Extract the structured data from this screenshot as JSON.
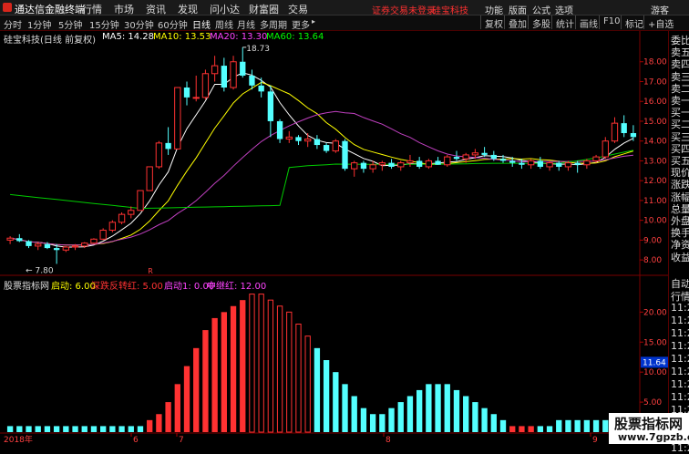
{
  "menubar": {
    "app_title": "通达信金融终端",
    "items": [
      "行情",
      "市场",
      "资讯",
      "发现",
      "问小达",
      "财富圈",
      "交易"
    ],
    "notice": "证券交易未登录",
    "stock": "硅宝科技",
    "right_items": [
      "功能",
      "版面",
      "公式",
      "选项"
    ],
    "guest": "游客"
  },
  "toolbar": {
    "periods": [
      "分时",
      "1分钟",
      "5分钟",
      "15分钟",
      "30分钟",
      "60分钟",
      "日线",
      "周线",
      "月线",
      "多周期",
      "更多"
    ],
    "active_period": "日线",
    "right_buttons": [
      "复权",
      "叠加",
      "多股",
      "统计",
      "画线",
      "F10",
      "标记",
      "+自选"
    ]
  },
  "main_chart": {
    "title": "硅宝科技(日线 前复权)",
    "ma_labels": [
      {
        "text": "MA5: 14.28",
        "color": "#ffffff"
      },
      {
        "text": "MA10: 13.53",
        "color": "#ffff00"
      },
      {
        "text": "MA20: 13.30",
        "color": "#ff44ff"
      },
      {
        "text": "MA60: 13.64",
        "color": "#00ff00"
      }
    ],
    "high_label": "18.73",
    "low_label": "7.80",
    "price_ticks": [
      "18.00",
      "17.00",
      "16.00",
      "15.00",
      "14.00",
      "13.00",
      "12.00",
      "11.00",
      "10.00",
      "9.00",
      "8.00"
    ],
    "marker_r": "R"
  },
  "sub_chart": {
    "title": "股票指标网",
    "legend": [
      {
        "text": "启动: 6.00",
        "color": "#ffff00"
      },
      {
        "text": "深跌反转红: 5.00",
        "color": "#ff3333"
      },
      {
        "text": "启动1: 0.00",
        "color": "#ff44ff"
      },
      {
        "text": "中继红: 12.00",
        "color": "#ff44ff"
      }
    ],
    "ticks": [
      "20.00",
      "15.00",
      "10.00",
      "5.00"
    ],
    "current_value": "11.64"
  },
  "xaxis": {
    "labels": [
      "2018年",
      "6",
      "7",
      "8",
      "9"
    ]
  },
  "right_panel": {
    "items": [
      "委比",
      "卖五",
      "卖四",
      "卖三",
      "卖二",
      "卖一",
      "买一",
      "买二",
      "买三",
      "买四",
      "买五",
      "现价",
      "涨跌",
      "涨幅",
      "总量",
      "外盘",
      "换手",
      "净资",
      "收益"
    ],
    "lower": [
      "自动",
      "行情",
      "11:2",
      "11:2",
      "11:2",
      "11:2",
      "11:2",
      "11:2",
      "11:2",
      "11:2",
      "11:2",
      "11:2",
      "11:2",
      "11:2"
    ]
  },
  "watermark": {
    "line1": "股票指标网",
    "line2": "www.7gpzb.com"
  },
  "colors": {
    "up": "#ff3232",
    "down": "#54ffff",
    "ma5": "#ffffff",
    "ma10": "#ffff00",
    "ma20": "#c040c0",
    "ma60": "#00cc00"
  },
  "chart_data": {
    "type": "candlestick",
    "candles": [
      [
        9.0,
        9.2,
        8.8,
        9.1
      ],
      [
        9.1,
        9.3,
        8.9,
        8.95
      ],
      [
        8.95,
        9.0,
        8.6,
        8.7
      ],
      [
        8.7,
        8.9,
        8.5,
        8.8
      ],
      [
        8.8,
        8.9,
        8.55,
        8.6
      ],
      [
        8.6,
        8.8,
        7.8,
        8.5
      ],
      [
        8.5,
        8.7,
        8.4,
        8.65
      ],
      [
        8.65,
        8.8,
        8.5,
        8.7
      ],
      [
        8.7,
        8.9,
        8.6,
        8.85
      ],
      [
        8.85,
        9.1,
        8.8,
        9.05
      ],
      [
        9.05,
        9.6,
        9.0,
        9.5
      ],
      [
        9.5,
        10.0,
        9.4,
        9.9
      ],
      [
        9.9,
        10.4,
        9.8,
        10.3
      ],
      [
        10.3,
        10.7,
        10.1,
        10.5
      ],
      [
        10.5,
        11.5,
        10.5,
        11.5
      ],
      [
        11.5,
        12.7,
        11.5,
        12.7
      ],
      [
        12.7,
        14.0,
        12.6,
        13.9
      ],
      [
        13.9,
        14.7,
        13.3,
        13.6
      ],
      [
        13.6,
        16.7,
        13.6,
        16.7
      ],
      [
        16.7,
        17.0,
        15.8,
        16.2
      ],
      [
        16.2,
        17.3,
        16.0,
        16.2
      ],
      [
        16.2,
        17.6,
        16.1,
        17.4
      ],
      [
        17.4,
        18.3,
        17.0,
        17.8
      ],
      [
        17.8,
        18.2,
        16.5,
        16.7
      ],
      [
        16.7,
        18.3,
        16.6,
        18.0
      ],
      [
        18.0,
        18.73,
        17.2,
        17.3
      ],
      [
        17.3,
        17.6,
        16.6,
        16.8
      ],
      [
        16.8,
        17.2,
        16.2,
        16.5
      ],
      [
        16.5,
        16.8,
        14.2,
        15.0
      ],
      [
        15.0,
        15.1,
        13.9,
        14.1
      ],
      [
        14.1,
        14.5,
        13.9,
        14.2
      ],
      [
        14.2,
        14.3,
        13.8,
        14.0
      ],
      [
        14.0,
        14.4,
        13.7,
        14.1
      ],
      [
        14.1,
        14.3,
        13.6,
        13.8
      ],
      [
        13.8,
        13.9,
        13.4,
        13.5
      ],
      [
        13.5,
        14.1,
        13.4,
        14.0
      ],
      [
        14.0,
        14.1,
        12.5,
        12.6
      ],
      [
        12.6,
        13.0,
        12.2,
        12.9
      ],
      [
        12.9,
        13.0,
        12.4,
        12.6
      ],
      [
        12.6,
        13.0,
        12.4,
        12.8
      ],
      [
        12.8,
        13.0,
        12.5,
        12.9
      ],
      [
        12.9,
        13.1,
        12.6,
        12.7
      ],
      [
        12.7,
        13.0,
        12.5,
        12.9
      ],
      [
        12.9,
        13.3,
        12.7,
        13.0
      ],
      [
        13.0,
        13.2,
        12.6,
        12.7
      ],
      [
        12.7,
        13.1,
        12.6,
        13.0
      ],
      [
        13.0,
        13.2,
        12.8,
        12.8
      ],
      [
        12.8,
        13.3,
        12.7,
        13.2
      ],
      [
        13.2,
        13.5,
        13.0,
        13.1
      ],
      [
        13.1,
        13.4,
        12.9,
        13.3
      ],
      [
        13.3,
        13.6,
        13.1,
        13.4
      ],
      [
        13.4,
        13.7,
        13.2,
        13.3
      ],
      [
        13.3,
        13.5,
        13.0,
        13.1
      ],
      [
        13.1,
        13.3,
        12.9,
        13.0
      ],
      [
        13.0,
        13.2,
        12.7,
        12.9
      ],
      [
        12.9,
        13.1,
        12.6,
        12.8
      ],
      [
        12.8,
        13.1,
        12.6,
        13.0
      ],
      [
        13.0,
        13.2,
        12.6,
        12.7
      ],
      [
        12.7,
        13.0,
        12.5,
        12.9
      ],
      [
        12.9,
        13.0,
        12.5,
        12.7
      ],
      [
        12.7,
        13.0,
        12.5,
        12.9
      ],
      [
        12.9,
        13.0,
        12.4,
        12.8
      ],
      [
        12.8,
        13.1,
        12.6,
        13.0
      ],
      [
        13.0,
        13.3,
        12.9,
        13.2
      ],
      [
        13.2,
        14.2,
        13.1,
        14.0
      ],
      [
        14.0,
        15.2,
        13.9,
        14.9
      ],
      [
        14.9,
        15.3,
        14.2,
        14.4
      ],
      [
        14.4,
        14.8,
        14.0,
        14.2
      ]
    ],
    "indicator": {
      "bars": [
        1,
        1,
        1,
        1,
        1,
        1,
        1,
        1,
        1,
        1,
        1,
        1,
        1,
        1,
        1,
        2,
        3,
        5,
        8,
        11,
        14,
        17,
        19,
        20,
        21,
        22,
        23,
        23,
        22,
        21,
        20,
        18,
        16,
        14,
        12,
        10,
        8,
        6,
        4,
        3,
        3,
        4,
        5,
        6,
        7,
        8,
        8,
        8,
        7,
        6,
        5,
        4,
        3,
        2,
        1,
        1,
        1,
        1,
        1,
        2,
        2,
        2,
        2,
        2,
        2,
        3,
        3,
        2
      ],
      "colors": [
        "c",
        "c",
        "c",
        "c",
        "c",
        "c",
        "c",
        "c",
        "c",
        "c",
        "c",
        "c",
        "c",
        "c",
        "c",
        "r",
        "r",
        "r",
        "r",
        "r",
        "r",
        "r",
        "r",
        "r",
        "r",
        "r",
        "ro",
        "ro",
        "ro",
        "ro",
        "ro",
        "ro",
        "ro",
        "c",
        "c",
        "c",
        "c",
        "c",
        "c",
        "c",
        "c",
        "c",
        "c",
        "c",
        "c",
        "c",
        "c",
        "c",
        "c",
        "c",
        "c",
        "c",
        "c",
        "c",
        "r",
        "r",
        "r",
        "c",
        "c",
        "c",
        "c",
        "c",
        "c",
        "c",
        "c",
        "c",
        "c",
        "r"
      ],
      "ylim": [
        0,
        24
      ]
    },
    "ylim": [
      7.5,
      19.0
    ],
    "ma5_last": 14.28,
    "ma10_last": 13.53,
    "ma20_last": 13.3,
    "ma60_last": 13.64
  }
}
